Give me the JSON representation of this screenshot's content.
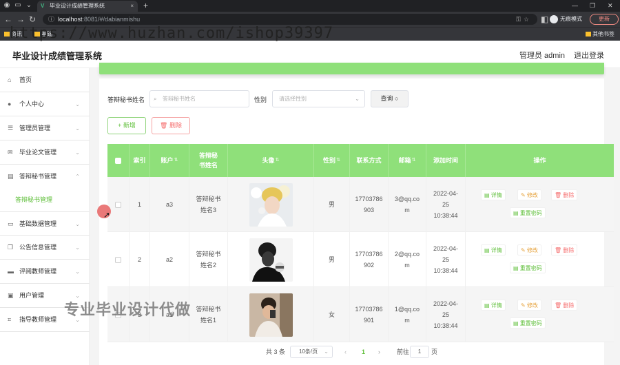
{
  "browser": {
    "tab_title": "毕业设计成绩管理系统",
    "url_host": "localhost",
    "url_rest": ":8081/#/dabianmishu",
    "incognito_label": "无痕模式",
    "update_label": "更新",
    "bookmarks": [
      "资讯",
      "基础",
      "其他书签"
    ]
  },
  "watermark": "https://www.huzhan.com/ishop39397",
  "overlay_text": "专业毕业设计代做",
  "header": {
    "title": "毕业设计成绩管理系统",
    "user": "管理员 admin",
    "logout": "退出登录"
  },
  "sidebar": {
    "items": [
      {
        "label": "首页",
        "icon": "home-icon"
      },
      {
        "label": "个人中心",
        "icon": "user-icon"
      },
      {
        "label": "管理员管理",
        "icon": "sliders-icon"
      },
      {
        "label": "毕业论文管理",
        "icon": "mail-icon"
      },
      {
        "label": "答辩秘书管理",
        "icon": "clipboard-icon"
      },
      {
        "label": "基础数据管理",
        "icon": "chat-icon"
      },
      {
        "label": "公告信息管理",
        "icon": "copy-icon"
      },
      {
        "label": "评阅教师管理",
        "icon": "message-icon"
      },
      {
        "label": "用户管理",
        "icon": "printer-icon"
      },
      {
        "label": "指导教师管理",
        "icon": "crop-icon"
      }
    ],
    "active_sub": "答辩秘书管理"
  },
  "search": {
    "name_label": "答辩秘书姓名",
    "name_placeholder": "答辩秘书姓名",
    "gender_label": "性别",
    "gender_placeholder": "请选择性别",
    "query_button": "查询"
  },
  "actions": {
    "add": "+ 新增",
    "delete": "删除"
  },
  "table": {
    "columns": [
      "索引",
      "账户",
      "答辩秘书姓名",
      "头像",
      "性别",
      "联系方式",
      "邮箱",
      "添加时间",
      "操作"
    ],
    "rows": [
      {
        "index": "1",
        "account": "a3",
        "name": "答辩秘书姓名3",
        "gender": "男",
        "phone": "17703786903",
        "email": "3@qq.com",
        "time": "2022-04-25 10:38:44"
      },
      {
        "index": "2",
        "account": "a2",
        "name": "答辩秘书姓名2",
        "gender": "男",
        "phone": "17703786902",
        "email": "2@qq.com",
        "time": "2022-04-25 10:38:44"
      },
      {
        "index": "3",
        "account": "a1",
        "name": "答辩秘书姓名1",
        "gender": "女",
        "phone": "17703786901",
        "email": "1@qq.com",
        "time": "2022-04-25 10:38:44"
      }
    ],
    "ops": {
      "detail": "详情",
      "edit": "修改",
      "delete": "删除",
      "reset": "重置密码"
    }
  },
  "pagination": {
    "total": "共 3 条",
    "page_size": "10条/页",
    "current": "1",
    "goto_label": "前往",
    "goto_value": "1",
    "page_suffix": "页"
  },
  "colors": {
    "accent": "#8fe07a",
    "accent_text": "#5fbf3a",
    "danger": "#f56c6c",
    "warning": "#e6a23c"
  }
}
